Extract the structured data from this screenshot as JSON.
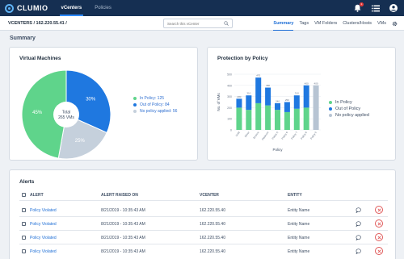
{
  "topnav": {
    "logo_text": "CLUMIO",
    "tabs": [
      {
        "label": "vCenters",
        "active": true
      },
      {
        "label": "Policies",
        "active": false
      }
    ],
    "notification_count": "1"
  },
  "subheader": {
    "breadcrumb": "VCENTERS / 162.220.55.41 /",
    "search_placeholder": "Search this vCenter",
    "tabs": [
      {
        "label": "Summary",
        "active": true
      },
      {
        "label": "Tags",
        "active": false
      },
      {
        "label": "VM Folders",
        "active": false
      },
      {
        "label": "Clusters/Hosts",
        "active": false
      },
      {
        "label": "VMs",
        "active": false
      }
    ]
  },
  "summary_title": "Summary",
  "virtual_machines": {
    "title": "Virtual Machines",
    "center_label_line1": "Total",
    "center_label_line2": "265 VMs",
    "legend": [
      {
        "label": "In Policy: 125",
        "color": "#5fd48b"
      },
      {
        "label": "Out of Policy: 84",
        "color": "#1f78e0"
      },
      {
        "label": "No policy applied: 56",
        "color": "#c5d0dc"
      }
    ]
  },
  "protection_by_policy": {
    "title": "Protection by Policy",
    "legend": [
      {
        "label": "In Policy",
        "color": "#5fd48b"
      },
      {
        "label": "Out of Policy",
        "color": "#1f78e0"
      },
      {
        "label": "No policy applied",
        "color": "#b7c4d3"
      }
    ]
  },
  "chart_data": [
    {
      "type": "pie",
      "title": "Virtual Machines",
      "categories": [
        "In Policy",
        "Out of Policy",
        "No policy applied"
      ],
      "values": [
        125,
        84,
        56
      ],
      "slice_labels": [
        "45%",
        "30%",
        "25%"
      ],
      "total_label": "Total 265 VMs",
      "colors": [
        "#5fd48b",
        "#1f78e0",
        "#c5d0dc"
      ]
    },
    {
      "type": "bar",
      "title": "Protection by Policy",
      "xlabel": "Policy",
      "ylabel": "No. of VMs",
      "ylim": [
        0,
        500
      ],
      "yticks": [
        0,
        100,
        200,
        300,
        400,
        500
      ],
      "categories": [
        "Gold",
        "Silver",
        "Bronze",
        "Platinum",
        "Policy 5",
        "Policy 6",
        "Policy 7",
        "Policy 8",
        "Policy 9"
      ],
      "series": [
        {
          "name": "In Policy",
          "values": [
            200,
            180,
            240,
            220,
            180,
            160,
            190,
            200,
            0
          ],
          "color": "#5fd48b"
        },
        {
          "name": "Out of Policy",
          "values": [
            80,
            130,
            230,
            160,
            60,
            90,
            120,
            200,
            0
          ],
          "color": "#1f78e0"
        },
        {
          "name": "No policy applied",
          "values": [
            0,
            0,
            0,
            0,
            0,
            0,
            0,
            0,
            400
          ],
          "color": "#b7c4d3"
        }
      ],
      "value_labels": [
        "280",
        "310",
        "470",
        "380",
        "240",
        "250",
        "310",
        "400",
        "400"
      ],
      "grid": true
    }
  ],
  "alerts": {
    "title": "Alerts",
    "columns": [
      "ALERT",
      "ALERT RAISED ON",
      "VCENTER",
      "ENTITY"
    ],
    "rows": [
      {
        "alert": "Policy Violated",
        "raised_on": "8/21/2019 - 10:35:43 AM",
        "vcenter": "162.220.55.40",
        "entity": "Entity Name"
      },
      {
        "alert": "Policy Violated",
        "raised_on": "8/21/2019 - 10:35:43 AM",
        "vcenter": "162.220.55.40",
        "entity": "Entity Name"
      },
      {
        "alert": "Policy Violated",
        "raised_on": "8/21/2019 - 10:35:43 AM",
        "vcenter": "162.220.55.40",
        "entity": "Entity Name"
      },
      {
        "alert": "Policy Violated",
        "raised_on": "8/21/2019 - 10:35:43 AM",
        "vcenter": "162.220.55.40",
        "entity": "Entity Name"
      }
    ]
  }
}
